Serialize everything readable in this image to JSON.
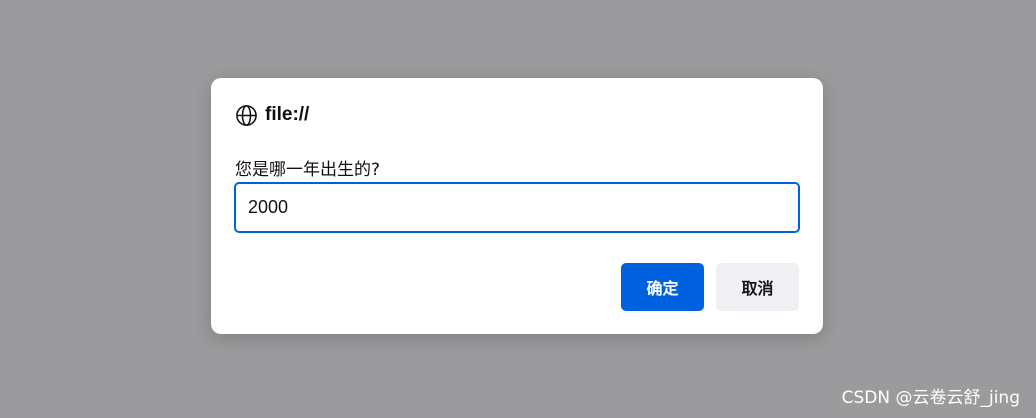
{
  "dialog": {
    "origin": "file://",
    "origin_icon": "globe-icon",
    "message": "您是哪一年出生的?",
    "input_value": "2000",
    "ok_label": "确定",
    "cancel_label": "取消"
  },
  "watermark": "CSDN @云卷云舒_jing",
  "colors": {
    "backdrop": "#9b9b9d",
    "accent": "#0061e0",
    "input_border": "#0060df",
    "secondary_button": "#f0f0f4"
  }
}
